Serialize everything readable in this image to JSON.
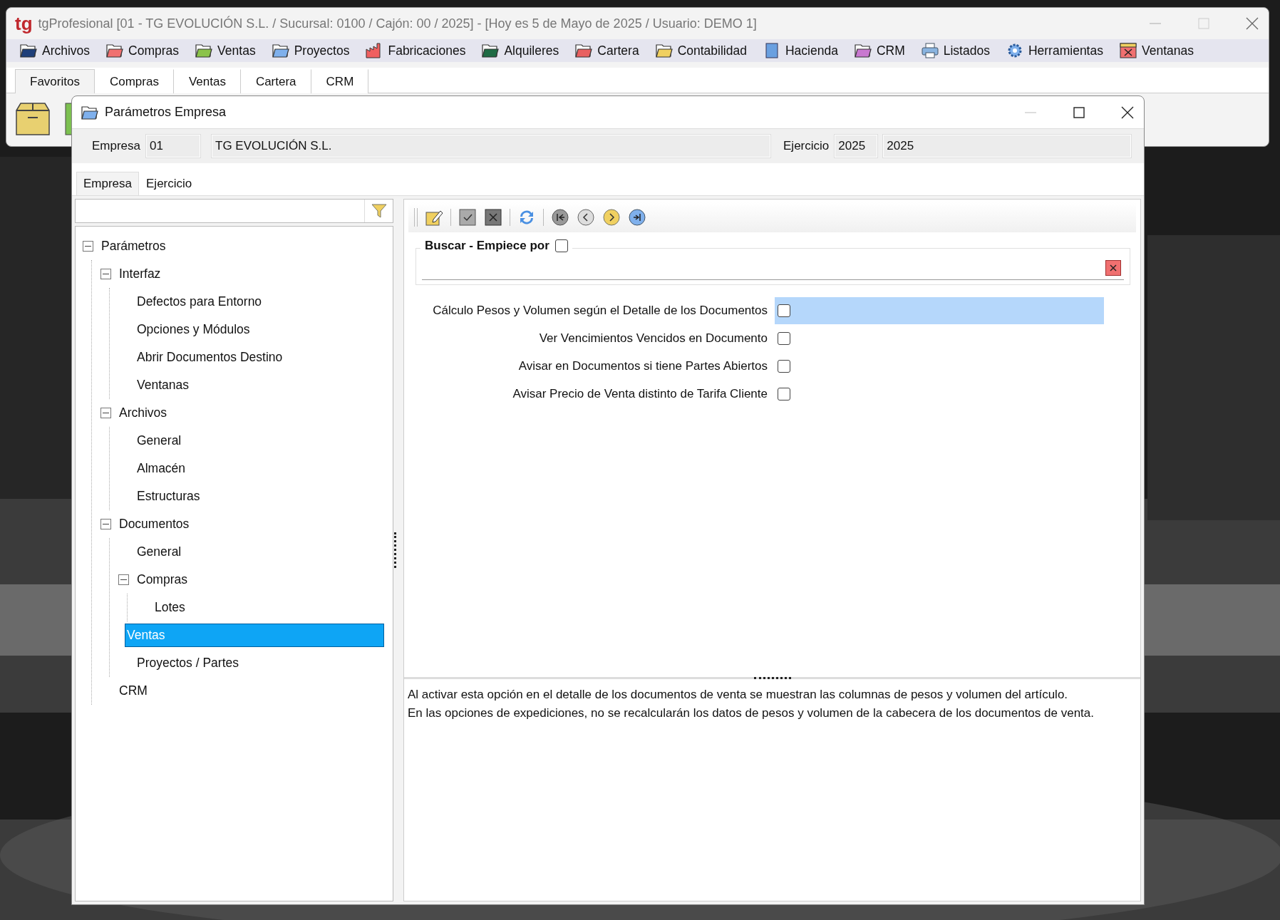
{
  "app_window": {
    "logo": "tg",
    "title": "tgProfesional [01 - TG EVOLUCIÓN S.L. / Sucursal: 0100 / Cajón: 00 / 2025] - [Hoy es 5 de Mayo de 2025 / Usuario: DEMO 1]"
  },
  "menu": [
    {
      "label": "Archivos",
      "kind": "folder",
      "color": "#1f3f7a"
    },
    {
      "label": "Compras",
      "kind": "folder",
      "color": "#f07070"
    },
    {
      "label": "Ventas",
      "kind": "folder",
      "color": "#8bc34a"
    },
    {
      "label": "Proyectos",
      "kind": "folder",
      "color": "#7fb0ec"
    },
    {
      "label": "Fabricaciones",
      "kind": "factory"
    },
    {
      "label": "Alquileres",
      "kind": "folder",
      "color": "#1f6b45"
    },
    {
      "label": "Cartera",
      "kind": "folder",
      "color": "#e86060"
    },
    {
      "label": "Contabilidad",
      "kind": "folder",
      "color": "#f0d060"
    },
    {
      "label": "Hacienda",
      "kind": "tax"
    },
    {
      "label": "CRM",
      "kind": "folder",
      "color": "#c878d0"
    },
    {
      "label": "Listados",
      "kind": "printer"
    },
    {
      "label": "Herramientas",
      "kind": "gear"
    },
    {
      "label": "Ventanas",
      "kind": "window"
    }
  ],
  "ribbon_tabs": [
    {
      "label": "Favoritos",
      "selected": true
    },
    {
      "label": "Compras",
      "selected": false
    },
    {
      "label": "Ventas",
      "selected": false
    },
    {
      "label": "Cartera",
      "selected": false
    },
    {
      "label": "CRM",
      "selected": false
    }
  ],
  "ribbon_items": [
    {
      "kind": "box"
    },
    {
      "kind": "green"
    }
  ],
  "dialog": {
    "title": "Parámetros Empresa",
    "header": {
      "empresa_label": "Empresa",
      "empresa_code": "01",
      "empresa_name": "TG EVOLUCIÓN S.L.",
      "ejercicio_label": "Ejercicio",
      "ejercicio_code": "2025",
      "ejercicio_name": "2025"
    },
    "tabs": [
      {
        "label": "Empresa",
        "selected": true
      },
      {
        "label": "Ejercicio",
        "selected": false
      }
    ],
    "tree": [
      {
        "label": "Parámetros",
        "selected": false,
        "expanded": true,
        "children": [
          {
            "label": "Interfaz",
            "selected": false,
            "expanded": true,
            "children": [
              {
                "label": "Defectos para Entorno",
                "selected": false
              },
              {
                "label": "Opciones y Módulos",
                "selected": false
              },
              {
                "label": "Abrir Documentos Destino",
                "selected": false
              },
              {
                "label": "Ventanas",
                "selected": false
              }
            ]
          },
          {
            "label": "Archivos",
            "selected": false,
            "expanded": true,
            "children": [
              {
                "label": "General",
                "selected": false
              },
              {
                "label": "Almacén",
                "selected": false
              },
              {
                "label": "Estructuras",
                "selected": false
              }
            ]
          },
          {
            "label": "Documentos",
            "selected": false,
            "expanded": true,
            "children": [
              {
                "label": "General",
                "selected": false
              },
              {
                "label": "Compras",
                "selected": false,
                "expanded": true,
                "children": [
                  {
                    "label": "Lotes",
                    "selected": false
                  }
                ]
              },
              {
                "label": "Ventas",
                "selected": true
              },
              {
                "label": "Proyectos / Partes",
                "selected": false
              }
            ]
          },
          {
            "label": "CRM",
            "selected": false
          }
        ]
      }
    ],
    "toolbar": [
      {
        "kind": "grip"
      },
      {
        "kind": "edit"
      },
      {
        "kind": "sep"
      },
      {
        "kind": "accept"
      },
      {
        "kind": "cancel"
      },
      {
        "kind": "sep"
      },
      {
        "kind": "refresh"
      },
      {
        "kind": "sep"
      },
      {
        "kind": "first"
      },
      {
        "kind": "prev"
      },
      {
        "kind": "next"
      },
      {
        "kind": "last"
      }
    ],
    "search": {
      "label": "Buscar - Empiece por",
      "checked": false
    },
    "options": [
      {
        "label": "Cálculo Pesos y Volumen según el Detalle de los Documentos",
        "checked": false,
        "selected": true
      },
      {
        "label": "Ver Vencimientos Vencidos en Documento",
        "checked": false,
        "selected": false
      },
      {
        "label": "Avisar en Documentos si tiene Partes Abiertos",
        "checked": false,
        "selected": false
      },
      {
        "label": "Avisar Precio de Venta distinto de Tarifa Cliente",
        "checked": false,
        "selected": false
      }
    ],
    "description": [
      "Al activar esta opción en el detalle de los documentos de venta se muestran las columnas de pesos y volumen del artículo.",
      "En las opciones de expediciones, no se recalcularán los datos de pesos y volumen de la cabecera de los documentos de venta."
    ]
  }
}
